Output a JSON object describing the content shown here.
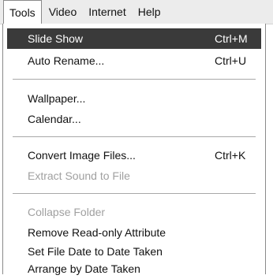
{
  "menubar": {
    "items": [
      "Tools",
      "Video",
      "Internet",
      "Help"
    ]
  },
  "menu": {
    "items": [
      {
        "label": "Slide Show",
        "shortcut": "Ctrl+M",
        "enabled": true,
        "highlighted": true
      },
      {
        "label": "Auto Rename...",
        "shortcut": "Ctrl+U",
        "enabled": true
      },
      {
        "label": "Wallpaper...",
        "shortcut": "",
        "enabled": true
      },
      {
        "label": "Calendar...",
        "shortcut": "",
        "enabled": true
      },
      {
        "label": "Convert Image Files...",
        "shortcut": "Ctrl+K",
        "enabled": true
      },
      {
        "label": "Extract Sound to File",
        "shortcut": "",
        "enabled": false
      },
      {
        "label": "Collapse Folder",
        "shortcut": "",
        "enabled": false
      },
      {
        "label": "Remove Read-only Attribute",
        "shortcut": "",
        "enabled": true
      },
      {
        "label": "Set File Date to Date Taken",
        "shortcut": "",
        "enabled": true
      },
      {
        "label": "Arrange by Date Taken",
        "shortcut": "",
        "enabled": true
      }
    ]
  },
  "colors": {
    "highlight_bg": "#3a3a3a",
    "disabled_text": "#a0a0a0"
  }
}
